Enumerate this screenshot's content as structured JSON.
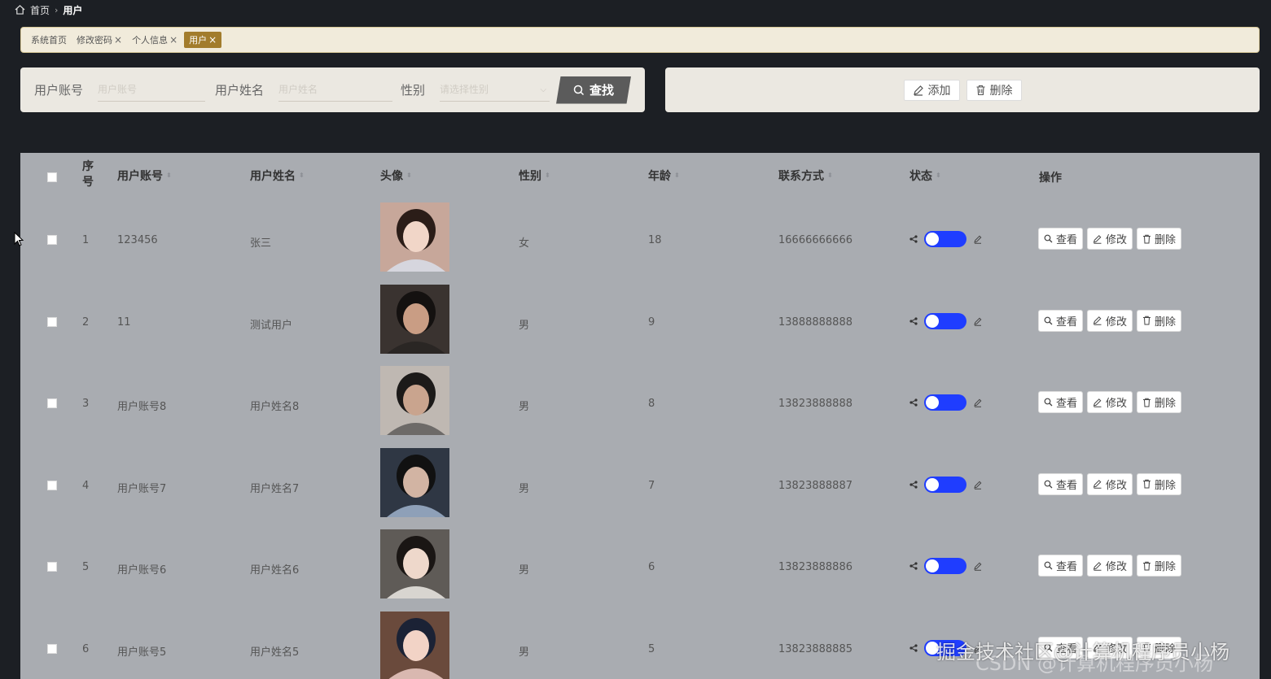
{
  "breadcrumb": {
    "home": "首页",
    "current": "用户"
  },
  "tags": [
    {
      "label": "系统首页",
      "closable": false,
      "active": false
    },
    {
      "label": "修改密码",
      "closable": true,
      "active": false
    },
    {
      "label": "个人信息",
      "closable": true,
      "active": false
    },
    {
      "label": "用户",
      "closable": true,
      "active": true
    }
  ],
  "search": {
    "account_label": "用户账号",
    "account_placeholder": "用户账号",
    "name_label": "用户姓名",
    "name_placeholder": "用户姓名",
    "gender_label": "性别",
    "gender_placeholder": "请选择性别",
    "find_label": "查找"
  },
  "actions": {
    "add_label": "添加",
    "delete_label": "删除"
  },
  "table": {
    "headers": {
      "index": "序\n号",
      "account": "用户账号",
      "name": "用户姓名",
      "avatar": "头像",
      "gender": "性别",
      "age": "年龄",
      "phone": "联系方式",
      "status": "状态",
      "ops": "操作"
    },
    "op_labels": {
      "view": "查看",
      "edit": "修改",
      "delete": "删除"
    },
    "rows": [
      {
        "index": "1",
        "account": "123456",
        "name": "张三",
        "gender": "女",
        "age": "18",
        "phone": "16666666666",
        "avatar_bg": "#c7a79a",
        "avatar_hair": "#2b1d18",
        "avatar_skin": "#f1d6c8",
        "avatar_cloth": "#d6d6de"
      },
      {
        "index": "2",
        "account": "11",
        "name": "测试用户",
        "gender": "男",
        "age": "9",
        "phone": "13888888888",
        "avatar_bg": "#3a3330",
        "avatar_hair": "#141110",
        "avatar_skin": "#c99d84",
        "avatar_cloth": "#2a2624"
      },
      {
        "index": "3",
        "account": "用户账号8",
        "name": "用户姓名8",
        "gender": "男",
        "age": "8",
        "phone": "13823888888",
        "avatar_bg": "#bfb8b2",
        "avatar_hair": "#1c1a19",
        "avatar_skin": "#c9a48e",
        "avatar_cloth": "#6d6a68"
      },
      {
        "index": "4",
        "account": "用户账号7",
        "name": "用户姓名7",
        "gender": "男",
        "age": "7",
        "phone": "13823888887",
        "avatar_bg": "#2f3744",
        "avatar_hair": "#111",
        "avatar_skin": "#d2b4a3",
        "avatar_cloth": "#8ea0b8"
      },
      {
        "index": "5",
        "account": "用户账号6",
        "name": "用户姓名6",
        "gender": "男",
        "age": "6",
        "phone": "13823888886",
        "avatar_bg": "#5f5b57",
        "avatar_hair": "#1a1614",
        "avatar_skin": "#eed8cb",
        "avatar_cloth": "#d8d5d0"
      },
      {
        "index": "6",
        "account": "用户账号5",
        "name": "用户姓名5",
        "gender": "男",
        "age": "5",
        "phone": "13823888885",
        "avatar_bg": "#6a4a3c",
        "avatar_hair": "#1b2235",
        "avatar_skin": "#f2d3c6",
        "avatar_cloth": "#d9b8b0"
      }
    ]
  },
  "watermark": {
    "front": "掘金技术社区@计算机程序员小杨",
    "back": "CSDN @计算机程序员小杨"
  },
  "colors": {
    "accent": "#a27c2c",
    "toggle_on": "#1f3dff",
    "table_bg": "#a9acb1"
  }
}
